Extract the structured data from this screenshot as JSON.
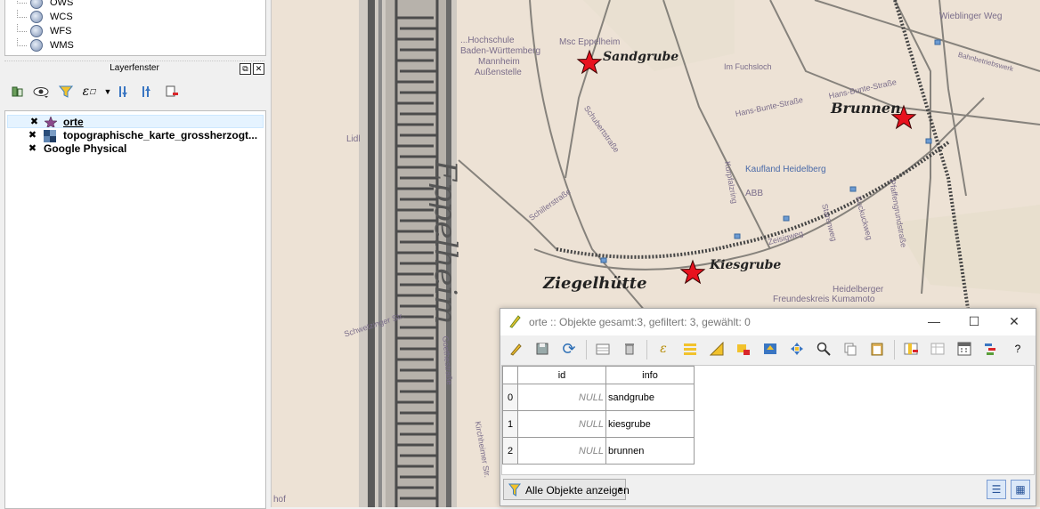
{
  "browser": {
    "items": [
      {
        "label": "OWS",
        "icon": "globe-icon"
      },
      {
        "label": "WCS",
        "icon": "globe-icon"
      },
      {
        "label": "WFS",
        "icon": "globe-icon"
      },
      {
        "label": "WMS",
        "icon": "globe-icon"
      }
    ]
  },
  "layer_panel": {
    "title": "Layerfenster",
    "layers": [
      {
        "name": "orte",
        "checked": true,
        "selected": true,
        "icon": "star-point-icon"
      },
      {
        "name": "topographische_karte_grossherzogt...",
        "checked": true,
        "selected": false,
        "icon": "raster-icon"
      },
      {
        "name": "Google Physical",
        "checked": true,
        "selected": false,
        "icon": ""
      }
    ]
  },
  "map": {
    "modern_labels": {
      "msc": "Msc Eppelheim",
      "hochschule1": "...Hochschule",
      "hochschule2": "Baden-Württemberg",
      "hochschule3": "Mannheim",
      "hochschule4": "Außenstelle",
      "fuchsloch": "Im Fuchsloch",
      "hans_bunte": "Hans-Bunte-Straße",
      "hans_bunte2": "Hans-Bunte-Straße",
      "kaufland": "Kaufland Heidelberg",
      "abb": "ABB",
      "wieblinger": "Wieblinger Weg",
      "bahnbetrieb": "Bahnbetriebswerk",
      "lidl": "Lidl",
      "schillerstr": "Schillerstraße",
      "schubertstr": "Schubertstraße",
      "kurpfalzring": "Kurpfalzring",
      "zeisigweg": "Zeisigweg",
      "staren": "Starenweg",
      "kuckuck": "Kuckuckweg",
      "pfaffen": "Pfaffengrundstraße",
      "heidelberger": "Heidelberger",
      "freundeskreis": "Freundeskreis Kumamoto",
      "schwetzinger": "Schwetzinger Str.",
      "goethe": "Goethestraße",
      "kirchheimer": "Kirchheimer Str.",
      "hof": "hof"
    },
    "old_labels": {
      "sandgrube": "Sandgrube",
      "brunnen": "Brunnen",
      "kiesgrube": "Kiesgrube",
      "ziegelhuette": "Ziegelhütte",
      "eppelheim": "Eppelheim"
    },
    "markers": [
      {
        "name": "sandgrube",
        "color": "#e8121e"
      },
      {
        "name": "brunnen",
        "color": "#e8121e"
      },
      {
        "name": "kiesgrube",
        "color": "#e8121e"
      }
    ]
  },
  "attribute_table": {
    "title": "orte :: Objekte gesamt:3, gefiltert: 3, gewählt: 0",
    "columns": [
      "id",
      "info"
    ],
    "rows": [
      {
        "num": "0",
        "id": "NULL",
        "info": "sandgrube"
      },
      {
        "num": "1",
        "id": "NULL",
        "info": "kiesgrube"
      },
      {
        "num": "2",
        "id": "NULL",
        "info": "brunnen"
      }
    ],
    "filter_button": "Alle Objekte anzeigen",
    "help": "?"
  },
  "colors": {
    "map_bg": "#eee3d8",
    "marker": "#e8121e",
    "selection": "#e5f3ff"
  }
}
